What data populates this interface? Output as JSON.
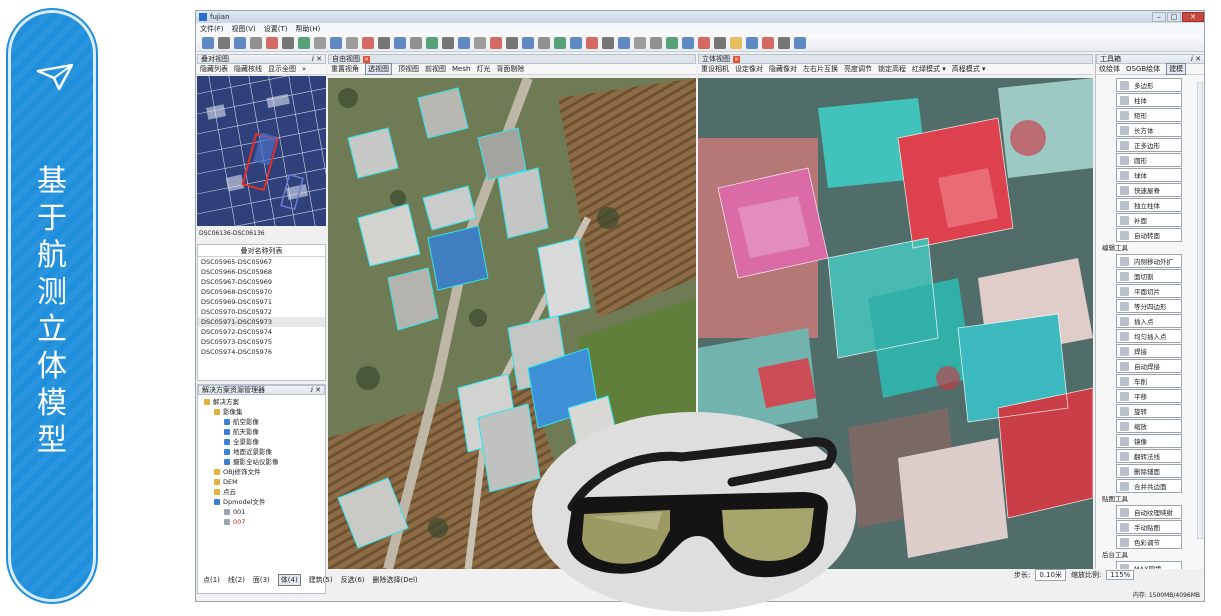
{
  "banner": {
    "title_chars": [
      "基",
      "于",
      "航",
      "测",
      "立",
      "体",
      "模",
      "型"
    ],
    "icon": "paper-plane-icon",
    "color": "#1f8fdc"
  },
  "window": {
    "title": "fujian",
    "menu": [
      "文件(F)",
      "视图(V)",
      "设置(T)",
      "帮助(H)"
    ]
  },
  "overlap_panel": {
    "title": "叠对视图",
    "tabs": [
      "隐藏列表",
      "隐藏核线",
      "显示全图"
    ],
    "more": "»",
    "caption": "DSC06136-DSC06136"
  },
  "name_list": {
    "header": "叠对名称列表",
    "items": [
      "DSC05965-DSC05967",
      "DSC05966-DSC05968",
      "DSC05967-DSC05969",
      "DSC05968-DSC05970",
      "DSC05969-DSC05971",
      "DSC05970-DSC05972",
      "DSC05971-DSC05973",
      "DSC05972-DSC05974",
      "DSC05973-DSC05975",
      "DSC05974-DSC05976"
    ],
    "selected_index": 6
  },
  "solution": {
    "title": "解决方案资源管理器",
    "rows": [
      {
        "indent": 0,
        "label": "解决方案",
        "color": "#e2b33c"
      },
      {
        "indent": 1,
        "label": "影像集",
        "color": "#e2b33c"
      },
      {
        "indent": 2,
        "label": "航空影像",
        "color": "#3d7fd0"
      },
      {
        "indent": 2,
        "label": "航天影像",
        "color": "#3d7fd0"
      },
      {
        "indent": 2,
        "label": "全景影像",
        "color": "#3d7fd0"
      },
      {
        "indent": 2,
        "label": "地面近景影像",
        "color": "#3d7fd0"
      },
      {
        "indent": 2,
        "label": "摄影全站仪影像",
        "color": "#3d7fd0"
      },
      {
        "indent": 1,
        "label": "OBJ修饰文件",
        "color": "#e2b33c"
      },
      {
        "indent": 1,
        "label": "DEM",
        "color": "#e2b33c"
      },
      {
        "indent": 1,
        "label": "点云",
        "color": "#e2b33c"
      },
      {
        "indent": 1,
        "label": "Dpmodel文件",
        "color": "#3d7fd0"
      },
      {
        "indent": 2,
        "label": "001",
        "color": "#9aa4b0"
      },
      {
        "indent": 2,
        "label": "007",
        "color": "#9aa4b0",
        "red": true
      }
    ]
  },
  "free_view": {
    "title": "自由视图",
    "tabs": [
      "重置视角",
      "透视图",
      "顶视图",
      "前视图",
      "Mesh",
      "灯光",
      "背面剔除"
    ],
    "active_tab": 1
  },
  "stereo_view": {
    "title": "立体视图",
    "tabs": [
      "重设相机",
      "设定像对",
      "隐藏像对",
      "左右片互换",
      "亮度调节",
      "锁定高程",
      "红绿模式 ▾",
      "高程模式 ▾"
    ]
  },
  "toolbox": {
    "title": "工具箱",
    "tabs": [
      "纹绘体",
      "OSGB绘体",
      "建模"
    ],
    "tools_top": [
      "多边形",
      "柱体",
      "矩形",
      "长方体",
      "正多边形",
      "圆形",
      "球体",
      "快速屋脊",
      "独立柱体",
      "补面",
      "自动转面"
    ],
    "section_edit": "编辑工具",
    "tools_edit": [
      "内侧移动外扩",
      "面切割",
      "平面切片",
      "等分四边形",
      "插入点",
      "均匀插入点",
      "焊接",
      "自动焊接",
      "车削",
      "平移",
      "旋转",
      "缩放",
      "镜像",
      "翻转法线",
      "删除辅面",
      "合并共边面"
    ],
    "section_map": "贴图工具",
    "tools_map": [
      "自动纹理映射",
      "手动贴图",
      "色彩调节"
    ],
    "section_bg": "后台工具",
    "tools_bg": [
      "MAX同步"
    ]
  },
  "statusbar": {
    "items": [
      "点(1)",
      "线(2)",
      "面(3)",
      "体(4)",
      "建筑(5)",
      "反选(6)",
      "删除选择(Del)"
    ],
    "selected_index": 3,
    "memory": "内存: 1500MB/4096MB"
  },
  "stereo_status": {
    "step_label": "步长:",
    "step_value": "0.10米",
    "scale_label": "缩放比例:",
    "scale_value": "115%"
  },
  "colors": {
    "accent": "#1f8fdc",
    "cyan_outline": "#2ee6f0",
    "red_select": "#e0302a"
  }
}
